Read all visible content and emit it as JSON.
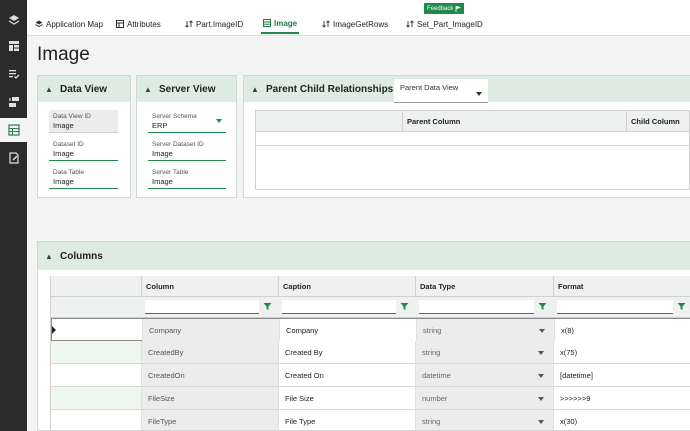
{
  "feedback": "Feedback",
  "tabs": [
    {
      "label": "Application Map"
    },
    {
      "label": "Attributes"
    },
    {
      "label": "Part.ImageID"
    },
    {
      "label": "Image"
    },
    {
      "label": "ImageGetRows"
    },
    {
      "label": "Set_Part_ImageID"
    }
  ],
  "page_title": "Image",
  "data_view": {
    "title": "Data View",
    "fields": [
      {
        "label": "Data View ID",
        "value": "Image"
      },
      {
        "label": "Dataset ID",
        "value": "Image"
      },
      {
        "label": "Data Table",
        "value": "Image"
      }
    ]
  },
  "server_view": {
    "title": "Server View",
    "fields": [
      {
        "label": "Server Schema",
        "value": "ERP"
      },
      {
        "label": "Server Dataset ID",
        "value": "Image"
      },
      {
        "label": "Server Table",
        "value": "Image"
      }
    ]
  },
  "parent_child": {
    "title": "Parent Child Relationships",
    "select": "Parent Data View",
    "columns": [
      "Parent Column",
      "Child Column"
    ]
  },
  "columns_panel": {
    "title": "Columns",
    "headers": [
      "Column",
      "Caption",
      "Data Type",
      "Format"
    ],
    "rows": [
      {
        "column": "Company",
        "caption": "Company",
        "type": "string",
        "format": "x(8)"
      },
      {
        "column": "CreatedBy",
        "caption": "Created By",
        "type": "string",
        "format": "x(75)"
      },
      {
        "column": "CreatedOn",
        "caption": "Created On",
        "type": "datetime",
        "format": "[datetime]"
      },
      {
        "column": "FileSize",
        "caption": "File Size",
        "type": "number",
        "format": ">>>>>>9"
      },
      {
        "column": "FileType",
        "caption": "File Type",
        "type": "string",
        "format": "x(30)"
      }
    ]
  },
  "colors": {
    "accent": "#1f8a4c",
    "nav_bg": "#2b2b2b",
    "panel_header": "#deebe2"
  }
}
